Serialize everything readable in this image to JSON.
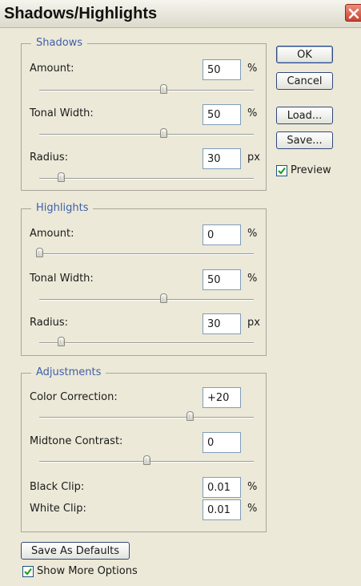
{
  "window": {
    "title": "Shadows/Highlights"
  },
  "shadows": {
    "legend": "Shadows",
    "amount": {
      "label": "Amount:",
      "value": "50",
      "unit": "%",
      "slider_fraction": 0.58
    },
    "tonal_width": {
      "label": "Tonal Width:",
      "value": "50",
      "unit": "%",
      "slider_fraction": 0.58
    },
    "radius": {
      "label": "Radius:",
      "value": "30",
      "unit": "px",
      "slider_fraction": 0.1
    }
  },
  "highlights": {
    "legend": "Highlights",
    "amount": {
      "label": "Amount:",
      "value": "0",
      "unit": "%",
      "slider_fraction": 0.0
    },
    "tonal_width": {
      "label": "Tonal Width:",
      "value": "50",
      "unit": "%",
      "slider_fraction": 0.58
    },
    "radius": {
      "label": "Radius:",
      "value": "30",
      "unit": "px",
      "slider_fraction": 0.1
    }
  },
  "adjustments": {
    "legend": "Adjustments",
    "color_correction": {
      "label": "Color Correction:",
      "value": "+20",
      "slider_fraction": 0.7
    },
    "midtone_contrast": {
      "label": "Midtone Contrast:",
      "value": "0",
      "slider_fraction": 0.5
    },
    "black_clip": {
      "label": "Black Clip:",
      "value": "0.01",
      "unit": "%"
    },
    "white_clip": {
      "label": "White Clip:",
      "value": "0.01",
      "unit": "%"
    }
  },
  "buttons": {
    "ok": "OK",
    "cancel": "Cancel",
    "load": "Load...",
    "save": "Save...",
    "save_defaults": "Save As Defaults"
  },
  "preview": {
    "label": "Preview",
    "checked": true
  },
  "show_more_options": {
    "label": "Show More Options",
    "checked": true
  },
  "colors": {
    "legend": "#3e5fa8",
    "check": "#21a121",
    "close": "#c84230"
  },
  "icons": {
    "close": "close-x-icon",
    "check": "checkmark-icon",
    "slider": "slider-thumb"
  }
}
